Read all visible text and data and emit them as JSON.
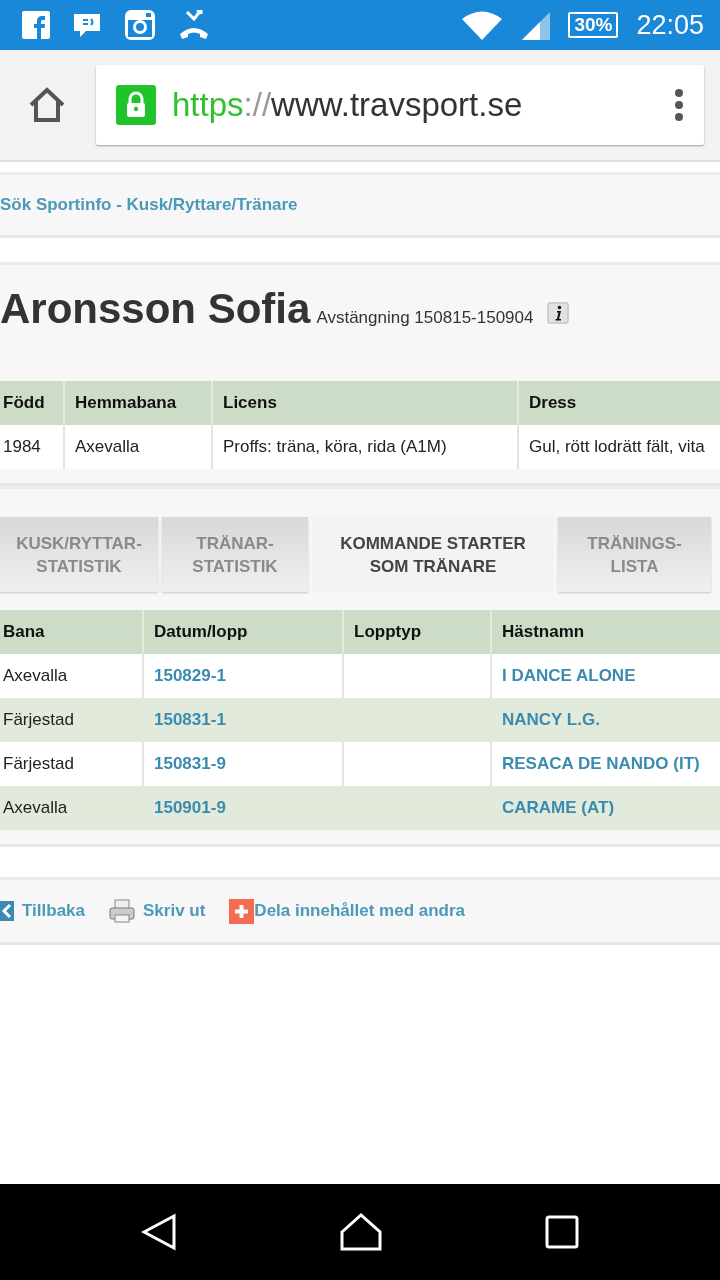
{
  "status_bar": {
    "battery": "30%",
    "time": "22:05"
  },
  "browser": {
    "url_scheme": "https",
    "url_separator": "://",
    "url_host": "www.travsport.se"
  },
  "breadcrumb": "Sök Sportinfo - Kusk/Ryttare/Tränare",
  "profile": {
    "name": "Aronsson Sofia",
    "suspension": "Avstängning 150815-150904"
  },
  "info_table": {
    "columns": [
      "Född",
      "Hemmabana",
      "Licens",
      "Dress"
    ],
    "rows": [
      [
        "1984",
        "Axevalla",
        "Proffs: träna, köra, rida (A1M)",
        "Gul, rött lodrätt fält, vita"
      ]
    ]
  },
  "tabs": [
    {
      "label": "KUSK/RYTTAR-STATISTIK",
      "selected": false
    },
    {
      "label": "TRÄNAR-STATISTIK",
      "selected": false
    },
    {
      "label": "KOMMANDE STARTER SOM TRÄNARE",
      "selected": true
    },
    {
      "label": "TRÄNINGS-LISTA",
      "selected": false
    }
  ],
  "starts_table": {
    "columns": [
      "Bana",
      "Datum/lopp",
      "Lopptyp",
      "Hästnamn"
    ],
    "rows": [
      {
        "track": "Axevalla",
        "race": "150829-1",
        "horse": "I DANCE ALONE"
      },
      {
        "track": "Färjestad",
        "race": "150831-1",
        "horse": "NANCY L.G."
      },
      {
        "track": "Färjestad",
        "race": "150831-9",
        "horse": "RESACA DE NANDO (IT)"
      },
      {
        "track": "Axevalla",
        "race": "150901-9",
        "horse": "CARAME (AT)"
      }
    ]
  },
  "footer_links": [
    {
      "kind": "back",
      "label": "Tillbaka"
    },
    {
      "kind": "print",
      "label": "Skriv ut"
    },
    {
      "kind": "share",
      "label": "Dela innehållet med andra"
    }
  ]
}
